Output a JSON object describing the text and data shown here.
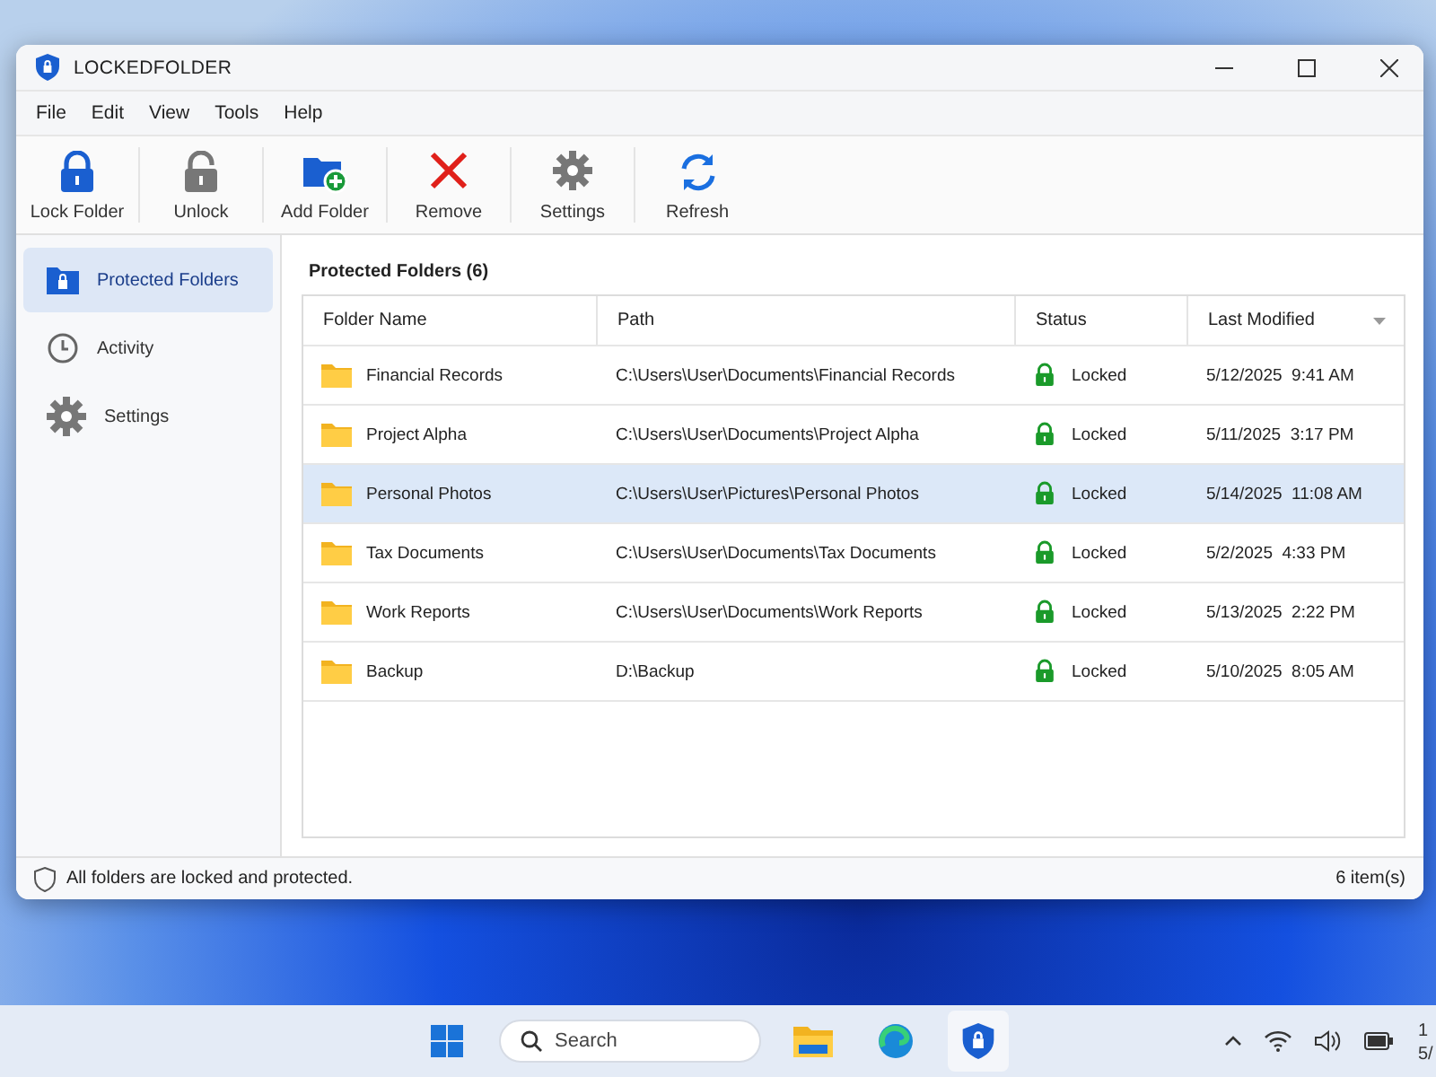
{
  "window": {
    "title": "LOCKEDFOLDER"
  },
  "menu": [
    "File",
    "Edit",
    "View",
    "Tools",
    "Help"
  ],
  "toolbar": [
    {
      "label": "Lock Folder"
    },
    {
      "label": "Unlock"
    },
    {
      "label": "Add Folder"
    },
    {
      "label": "Remove"
    },
    {
      "label": "Settings"
    },
    {
      "label": "Refresh"
    }
  ],
  "sidebar": {
    "items": [
      {
        "label": "Protected Folders",
        "selected": true
      },
      {
        "label": "Activity",
        "selected": false
      },
      {
        "label": "Settings",
        "selected": false
      }
    ]
  },
  "content": {
    "title": "Protected Folders (6)"
  },
  "table": {
    "columns": [
      "Folder Name",
      "Path",
      "Status",
      "Last Modified"
    ],
    "rows": [
      {
        "name": "Financial Records",
        "path": "C:\\Users\\User\\Documents\\Financial Records",
        "status": "Locked",
        "modified": "5/12/2025  9:41 AM",
        "selected": false
      },
      {
        "name": "Project Alpha",
        "path": "C:\\Users\\User\\Documents\\Project Alpha",
        "status": "Locked",
        "modified": "5/11/2025  3:17 PM",
        "selected": false
      },
      {
        "name": "Personal Photos",
        "path": "C:\\Users\\User\\Pictures\\Personal Photos",
        "status": "Locked",
        "modified": "5/14/2025  11:08 AM",
        "selected": true
      },
      {
        "name": "Tax Documents",
        "path": "C:\\Users\\User\\Documents\\Tax Documents",
        "status": "Locked",
        "modified": "5/2/2025  4:33 PM",
        "selected": false
      },
      {
        "name": "Work Reports",
        "path": "C:\\Users\\User\\Documents\\Work Reports",
        "status": "Locked",
        "modified": "5/13/2025  2:22 PM",
        "selected": false
      },
      {
        "name": "Backup",
        "path": "D:\\Backup",
        "status": "Locked",
        "modified": "5/10/2025  8:05 AM",
        "selected": false
      }
    ]
  },
  "status_bar": {
    "message": "All folders are locked and protected.",
    "count": "6 item(s)"
  },
  "taskbar": {
    "search": {
      "placeholder": "Search"
    },
    "clock": [
      "1",
      "5/"
    ]
  }
}
